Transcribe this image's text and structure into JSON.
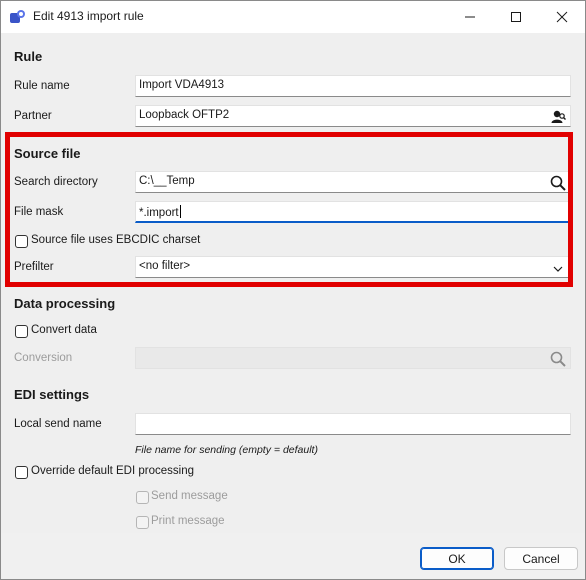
{
  "window": {
    "title": "Edit 4913 import rule",
    "controls": {
      "minimize_icon": "minimize-icon",
      "maximize_icon": "maximize-icon",
      "close_icon": "close-icon"
    }
  },
  "rule": {
    "heading": "Rule",
    "rule_name_label": "Rule name",
    "rule_name_value": "Import VDA4913",
    "partner_label": "Partner",
    "partner_value": "Loopback OFTP2",
    "partner_icon": "partner-lookup-icon"
  },
  "source_file": {
    "heading": "Source file",
    "search_dir_label": "Search directory",
    "search_dir_value": "C:\\__Temp",
    "search_icon": "search-icon",
    "file_mask_label": "File mask",
    "file_mask_value": "*.import",
    "ebcdic_label": "Source file uses EBCDIC charset",
    "ebcdic_checked": false,
    "prefilter_label": "Prefilter",
    "prefilter_value": "<no filter>",
    "highlight_color": "#e10000"
  },
  "data_processing": {
    "heading": "Data processing",
    "convert_label": "Convert data",
    "convert_checked": false,
    "conversion_label": "Conversion",
    "conversion_value": ""
  },
  "edi": {
    "heading": "EDI settings",
    "local_send_label": "Local send name",
    "local_send_value": "",
    "local_send_hint": "File name for sending (empty = default)",
    "override_label": "Override default EDI processing",
    "override_checked": false,
    "send_message_label": "Send message",
    "print_message_label": "Print message"
  },
  "footer": {
    "ok_label": "OK",
    "cancel_label": "Cancel"
  },
  "colors": {
    "accent": "#0a5cc8",
    "highlight": "#e10000"
  }
}
